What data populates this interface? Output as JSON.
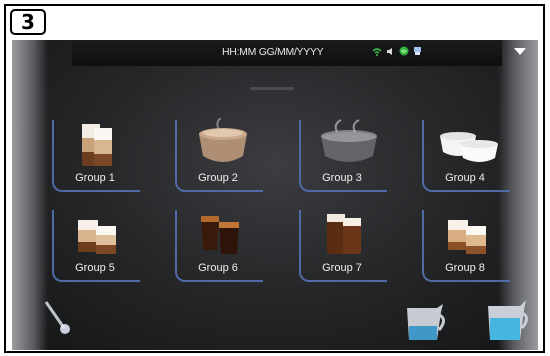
{
  "step_badge": "3",
  "topbar": {
    "datetime": "HH:MM GG/MM/YYYY"
  },
  "status_icons": [
    "wifi-icon",
    "volume-icon",
    "globe-icon",
    "usb-icon"
  ],
  "groups": [
    {
      "label": "Group 1",
      "drink": "latte-macchiato-icon"
    },
    {
      "label": "Group 2",
      "drink": "cappuccino-icon"
    },
    {
      "label": "Group 3",
      "drink": "hot-water-cup-icon"
    },
    {
      "label": "Group 4",
      "drink": "milk-cups-icon"
    },
    {
      "label": "Group 5",
      "drink": "double-latte-icon"
    },
    {
      "label": "Group 6",
      "drink": "espresso-double-icon"
    },
    {
      "label": "Group 7",
      "drink": "two-glasses-icon"
    },
    {
      "label": "Group 8",
      "drink": "two-lattes-icon"
    }
  ],
  "colors": {
    "accent": "#4f6aa8",
    "screen": "#26282a"
  }
}
